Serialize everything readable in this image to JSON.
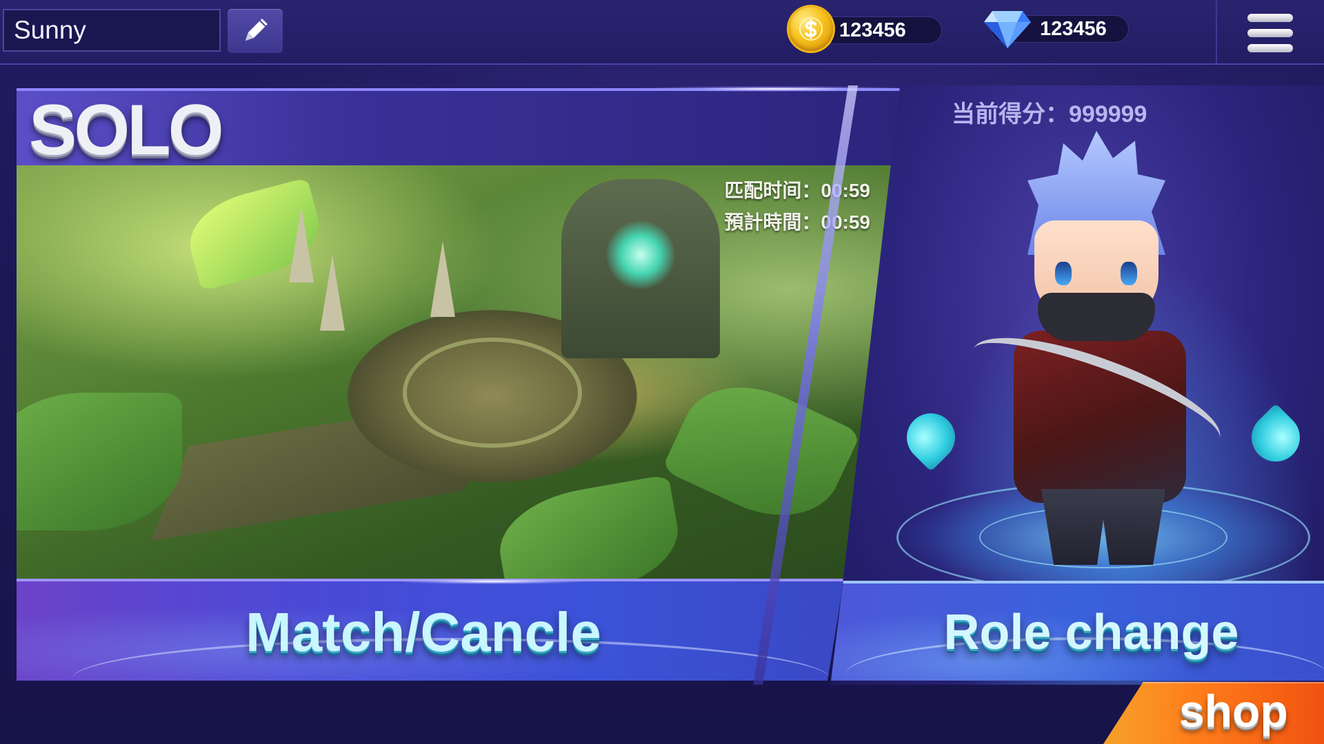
{
  "player": {
    "name": "Sunny"
  },
  "currency": {
    "coins": "123456",
    "gems": "123456"
  },
  "mode": {
    "title": "SOLO"
  },
  "timers": {
    "match_time": "匹配时间：00:59",
    "estimated_time": "預計時間：00:59"
  },
  "score": {
    "label": "当前得分：999999"
  },
  "buttons": {
    "match": "Match/Cancle",
    "role_change": "Role change",
    "shop": "shop"
  },
  "icons": {
    "edit": "pencil-icon",
    "coin": "coin-icon",
    "gem": "diamond-icon",
    "menu": "hamburger-menu-icon"
  },
  "colors": {
    "background": "#1b1850",
    "accent": "#5b4fc8",
    "coin": "#f6c21b",
    "gem": "#3a8bff",
    "shop": "#ff7b1a",
    "button_text": "#c9f6ff"
  }
}
